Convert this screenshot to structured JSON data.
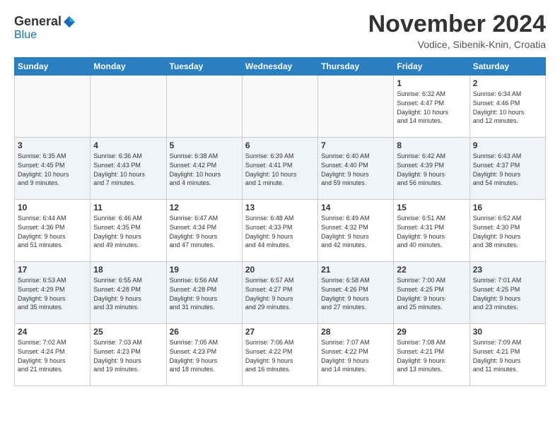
{
  "header": {
    "logo_general": "General",
    "logo_blue": "Blue",
    "month": "November 2024",
    "location": "Vodice, Sibenik-Knin, Croatia"
  },
  "weekdays": [
    "Sunday",
    "Monday",
    "Tuesday",
    "Wednesday",
    "Thursday",
    "Friday",
    "Saturday"
  ],
  "weeks": [
    [
      {
        "day": "",
        "info": ""
      },
      {
        "day": "",
        "info": ""
      },
      {
        "day": "",
        "info": ""
      },
      {
        "day": "",
        "info": ""
      },
      {
        "day": "",
        "info": ""
      },
      {
        "day": "1",
        "info": "Sunrise: 6:32 AM\nSunset: 4:47 PM\nDaylight: 10 hours\nand 14 minutes."
      },
      {
        "day": "2",
        "info": "Sunrise: 6:34 AM\nSunset: 4:46 PM\nDaylight: 10 hours\nand 12 minutes."
      }
    ],
    [
      {
        "day": "3",
        "info": "Sunrise: 6:35 AM\nSunset: 4:45 PM\nDaylight: 10 hours\nand 9 minutes."
      },
      {
        "day": "4",
        "info": "Sunrise: 6:36 AM\nSunset: 4:43 PM\nDaylight: 10 hours\nand 7 minutes."
      },
      {
        "day": "5",
        "info": "Sunrise: 6:38 AM\nSunset: 4:42 PM\nDaylight: 10 hours\nand 4 minutes."
      },
      {
        "day": "6",
        "info": "Sunrise: 6:39 AM\nSunset: 4:41 PM\nDaylight: 10 hours\nand 1 minute."
      },
      {
        "day": "7",
        "info": "Sunrise: 6:40 AM\nSunset: 4:40 PM\nDaylight: 9 hours\nand 59 minutes."
      },
      {
        "day": "8",
        "info": "Sunrise: 6:42 AM\nSunset: 4:39 PM\nDaylight: 9 hours\nand 56 minutes."
      },
      {
        "day": "9",
        "info": "Sunrise: 6:43 AM\nSunset: 4:37 PM\nDaylight: 9 hours\nand 54 minutes."
      }
    ],
    [
      {
        "day": "10",
        "info": "Sunrise: 6:44 AM\nSunset: 4:36 PM\nDaylight: 9 hours\nand 51 minutes."
      },
      {
        "day": "11",
        "info": "Sunrise: 6:46 AM\nSunset: 4:35 PM\nDaylight: 9 hours\nand 49 minutes."
      },
      {
        "day": "12",
        "info": "Sunrise: 6:47 AM\nSunset: 4:34 PM\nDaylight: 9 hours\nand 47 minutes."
      },
      {
        "day": "13",
        "info": "Sunrise: 6:48 AM\nSunset: 4:33 PM\nDaylight: 9 hours\nand 44 minutes."
      },
      {
        "day": "14",
        "info": "Sunrise: 6:49 AM\nSunset: 4:32 PM\nDaylight: 9 hours\nand 42 minutes."
      },
      {
        "day": "15",
        "info": "Sunrise: 6:51 AM\nSunset: 4:31 PM\nDaylight: 9 hours\nand 40 minutes."
      },
      {
        "day": "16",
        "info": "Sunrise: 6:52 AM\nSunset: 4:30 PM\nDaylight: 9 hours\nand 38 minutes."
      }
    ],
    [
      {
        "day": "17",
        "info": "Sunrise: 6:53 AM\nSunset: 4:29 PM\nDaylight: 9 hours\nand 35 minutes."
      },
      {
        "day": "18",
        "info": "Sunrise: 6:55 AM\nSunset: 4:28 PM\nDaylight: 9 hours\nand 33 minutes."
      },
      {
        "day": "19",
        "info": "Sunrise: 6:56 AM\nSunset: 4:28 PM\nDaylight: 9 hours\nand 31 minutes."
      },
      {
        "day": "20",
        "info": "Sunrise: 6:57 AM\nSunset: 4:27 PM\nDaylight: 9 hours\nand 29 minutes."
      },
      {
        "day": "21",
        "info": "Sunrise: 6:58 AM\nSunset: 4:26 PM\nDaylight: 9 hours\nand 27 minutes."
      },
      {
        "day": "22",
        "info": "Sunrise: 7:00 AM\nSunset: 4:25 PM\nDaylight: 9 hours\nand 25 minutes."
      },
      {
        "day": "23",
        "info": "Sunrise: 7:01 AM\nSunset: 4:25 PM\nDaylight: 9 hours\nand 23 minutes."
      }
    ],
    [
      {
        "day": "24",
        "info": "Sunrise: 7:02 AM\nSunset: 4:24 PM\nDaylight: 9 hours\nand 21 minutes."
      },
      {
        "day": "25",
        "info": "Sunrise: 7:03 AM\nSunset: 4:23 PM\nDaylight: 9 hours\nand 19 minutes."
      },
      {
        "day": "26",
        "info": "Sunrise: 7:05 AM\nSunset: 4:23 PM\nDaylight: 9 hours\nand 18 minutes."
      },
      {
        "day": "27",
        "info": "Sunrise: 7:06 AM\nSunset: 4:22 PM\nDaylight: 9 hours\nand 16 minutes."
      },
      {
        "day": "28",
        "info": "Sunrise: 7:07 AM\nSunset: 4:22 PM\nDaylight: 9 hours\nand 14 minutes."
      },
      {
        "day": "29",
        "info": "Sunrise: 7:08 AM\nSunset: 4:21 PM\nDaylight: 9 hours\nand 13 minutes."
      },
      {
        "day": "30",
        "info": "Sunrise: 7:09 AM\nSunset: 4:21 PM\nDaylight: 9 hours\nand 11 minutes."
      }
    ]
  ]
}
